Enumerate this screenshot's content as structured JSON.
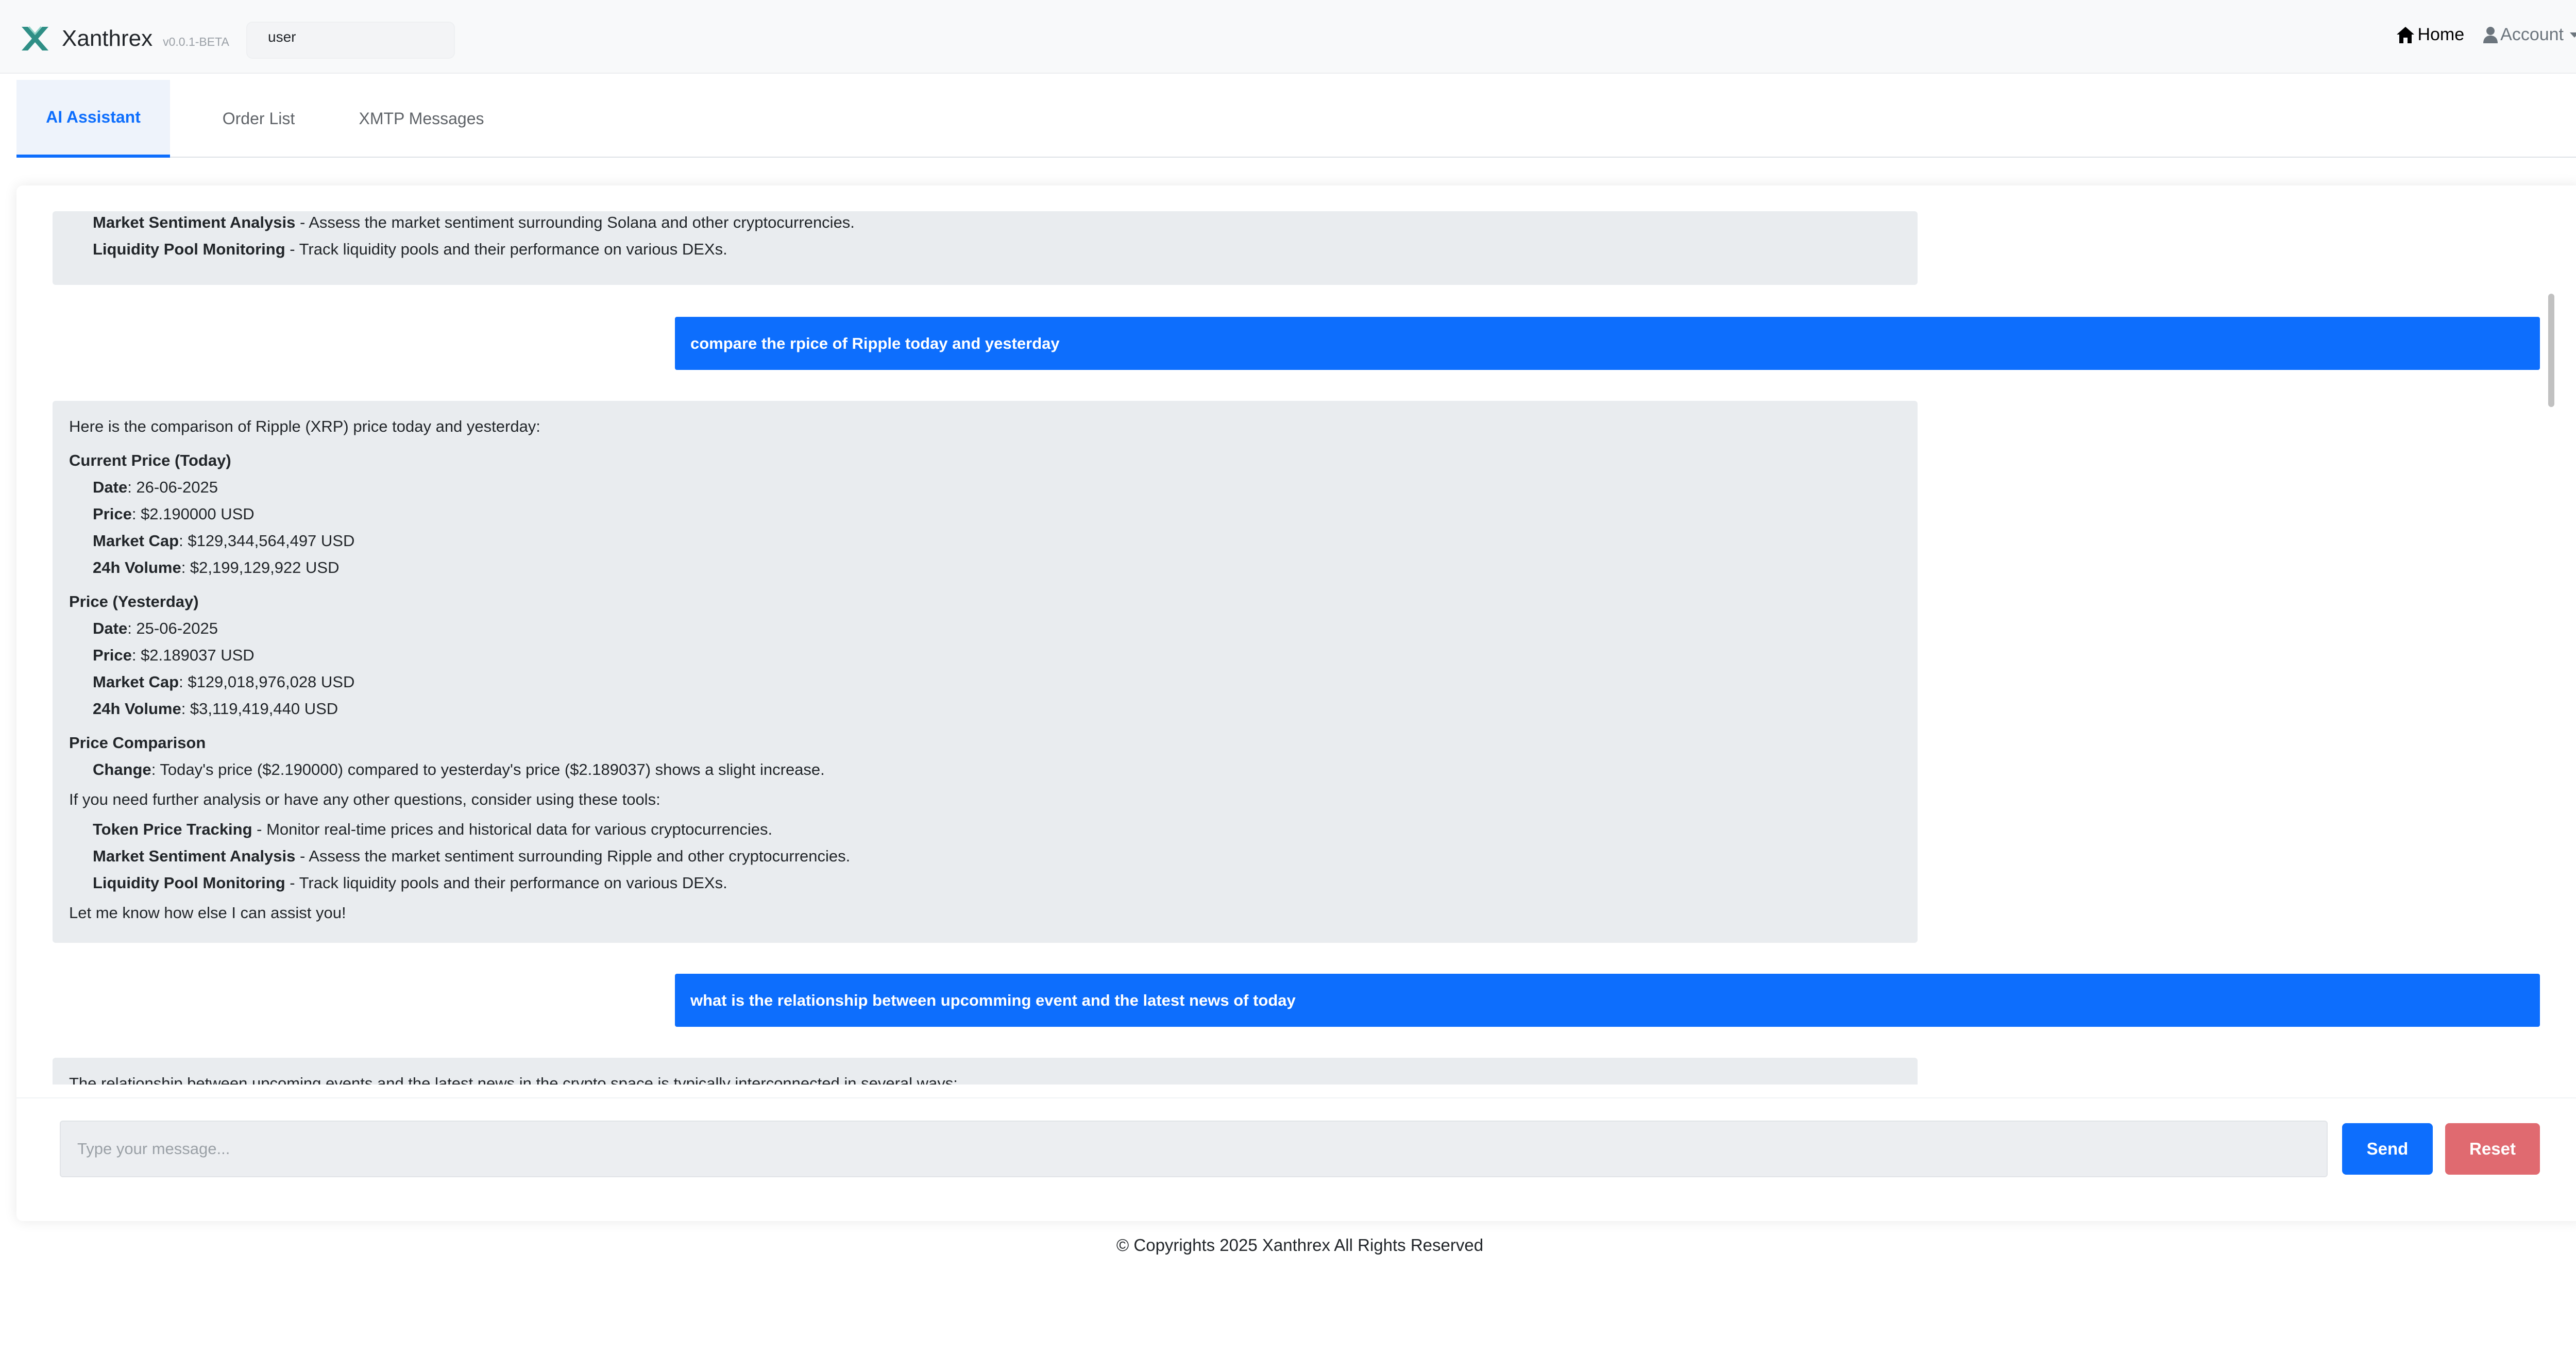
{
  "navbar": {
    "brand": "Xanthrex",
    "version": "v0.0.1-BETA",
    "user_select": "user",
    "home": "Home",
    "account": "Account"
  },
  "tabs": [
    "AI Assistant",
    "Order List",
    "XMTP Messages"
  ],
  "chat": {
    "bot1": [
      {
        "bold": "Market Sentiment Analysis",
        "text": " - Assess the market sentiment surrounding Solana and other cryptocurrencies."
      },
      {
        "bold": "Liquidity Pool Monitoring",
        "text": " - Track liquidity pools and their performance on various DEXs."
      }
    ],
    "user1": "compare the rpice of Ripple today and yesterday",
    "bot2": {
      "intro": "Here is the comparison of Ripple (XRP) price today and yesterday:",
      "today_heading": "Current Price (Today)",
      "today": [
        {
          "bold": "Date",
          "text": ": 26-06-2025"
        },
        {
          "bold": "Price",
          "text": ": $2.190000 USD"
        },
        {
          "bold": "Market Cap",
          "text": ": $129,344,564,497 USD"
        },
        {
          "bold": "24h Volume",
          "text": ": $2,199,129,922 USD"
        }
      ],
      "yesterday_heading": "Price (Yesterday)",
      "yesterday": [
        {
          "bold": "Date",
          "text": ": 25-06-2025"
        },
        {
          "bold": "Price",
          "text": ": $2.189037 USD"
        },
        {
          "bold": "Market Cap",
          "text": ": $129,018,976,028 USD"
        },
        {
          "bold": "24h Volume",
          "text": ": $3,119,419,440 USD"
        }
      ],
      "comparison_heading": "Price Comparison",
      "comparison": {
        "bold": "Change",
        "text": ": Today's price ($2.190000) compared to yesterday's price ($2.189037) shows a slight increase."
      },
      "tools_intro": "If you need further analysis or have any other questions, consider using these tools:",
      "tools": [
        {
          "bold": "Token Price Tracking",
          "text": " - Monitor real-time prices and historical data for various cryptocurrencies."
        },
        {
          "bold": "Market Sentiment Analysis",
          "text": " - Assess the market sentiment surrounding Ripple and other cryptocurrencies."
        },
        {
          "bold": "Liquidity Pool Monitoring",
          "text": " - Track liquidity pools and their performance on various DEXs."
        }
      ],
      "closing": "Let me know how else I can assist you!"
    },
    "user2": "what is the relationship between upcomming event and the latest news of today",
    "bot3_partial": "The relationship between upcoming events and the latest news in the crypto space is typically interconnected in several ways:"
  },
  "input": {
    "placeholder": "Type your message...",
    "send": "Send",
    "reset": "Reset"
  },
  "footer": "© Copyrights 2025 Xanthrex All Rights Reserved",
  "colors": {
    "primary": "#0d6efd",
    "reset": "#e06a70",
    "bot_bubble": "#e9ecef",
    "logo": "#2f8f86"
  }
}
